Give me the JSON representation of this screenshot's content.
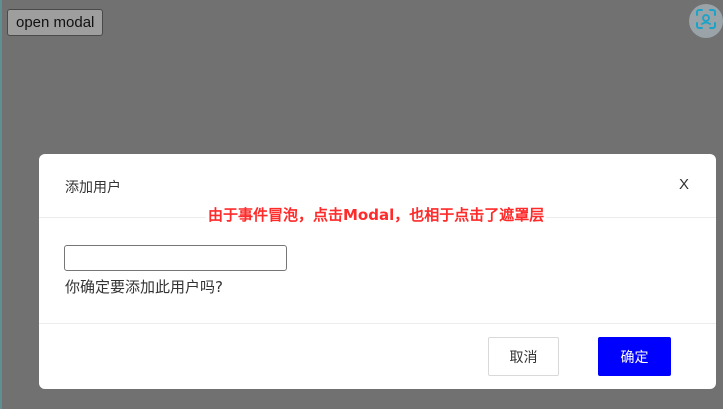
{
  "page": {
    "open_button_label": "open modal",
    "overlay_color": "#717171"
  },
  "floating_button": {
    "icon": "scan-icon",
    "accent": "#1aa3c8"
  },
  "modal": {
    "title": "添加用户",
    "close_label": "X",
    "annotation": "由于事件冒泡，点击Modal，也相于点击了遮罩层",
    "input_value": "",
    "question": "你确定要添加此用户吗?",
    "cancel_label": "取消",
    "ok_label": "确定",
    "ok_color": "#0000ff",
    "annotation_color": "#ff2a2a"
  }
}
